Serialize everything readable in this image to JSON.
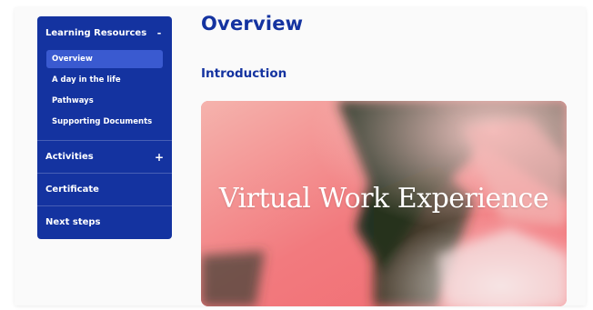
{
  "sidebar": {
    "group": {
      "title": "Learning Resources",
      "toggle": "-",
      "items": [
        {
          "label": "Overview",
          "active": true
        },
        {
          "label": "A day in the life",
          "active": false
        },
        {
          "label": "Pathways",
          "active": false
        },
        {
          "label": "Supporting Documents",
          "active": false
        }
      ]
    },
    "activities": {
      "label": "Activities",
      "toggle": "+"
    },
    "certificate": {
      "label": "Certificate"
    },
    "next_steps": {
      "label": "Next steps"
    }
  },
  "main": {
    "title": "Overview",
    "section": "Introduction",
    "hero": {
      "text": "Virtual Work Experience"
    }
  },
  "colors": {
    "brand": "#1433a0",
    "active_item": "#3a5ad0",
    "hero_pink": "#f07a7a",
    "hero_dark": "#2b3326"
  }
}
